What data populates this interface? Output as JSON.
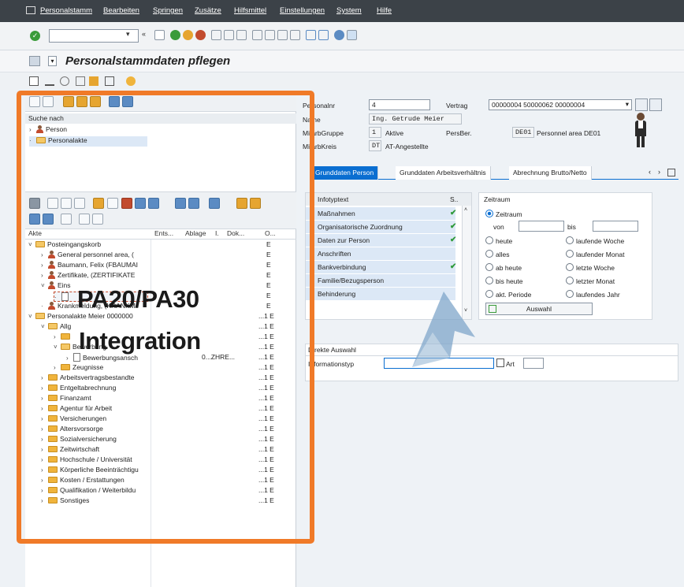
{
  "menubar": {
    "items": [
      "Personalstamm",
      "Bearbeiten",
      "Springen",
      "Zusätze",
      "Hilfsmittel",
      "Einstellungen",
      "System",
      "Hilfe"
    ]
  },
  "title": {
    "text": "Personalstammdaten pflegen"
  },
  "left": {
    "search_header": "Suche nach",
    "search_tree": [
      {
        "label": "Person",
        "expander": "›"
      },
      {
        "label": "Personalakte",
        "expander": "·"
      }
    ],
    "columns": [
      "Akte",
      "Ents...",
      "Ablage",
      "I.",
      "Dok...",
      "O..."
    ],
    "tree": [
      {
        "label": "Posteingangskorb",
        "e": "E",
        "expander": "˅"
      },
      {
        "label": "General personnel area, (",
        "e": "E",
        "expander": "›"
      },
      {
        "label": "Baumann, Felix (FBAUMAI",
        "e": "E",
        "expander": "›"
      },
      {
        "label": "Zertifikate, (ZERTIFIKATE",
        "e": "E",
        "expander": "›"
      },
      {
        "label": "Eins",
        "e": "E",
        "expander": "˅"
      },
      {
        "label": "",
        "e": "E",
        "expander": "·"
      },
      {
        "label": "Krankmeldung, (KRANKM",
        "e": "E",
        "expander": "·"
      },
      {
        "label": "Personalakte Meier 0000000",
        "e": "...1 E",
        "expander": "˅"
      },
      {
        "label": "Allg",
        "e": "...1 E",
        "expander": "˅"
      },
      {
        "label": "",
        "e": "...1 E",
        "expander": "›"
      },
      {
        "label": "Bewerbung",
        "e": "...1 E",
        "expander": "˅"
      },
      {
        "label": "Bewerbungsansch",
        "e": "...1 E",
        "expander": "›",
        "extra": "0...ZHRE..."
      },
      {
        "label": "Zeugnisse",
        "e": "...1 E",
        "expander": "›"
      },
      {
        "label": "Arbeitsvertragsbestandte",
        "e": "...1 E",
        "expander": "›"
      },
      {
        "label": "Entgeltabrechnung",
        "e": "...1 E",
        "expander": "›"
      },
      {
        "label": "Finanzamt",
        "e": "...1 E",
        "expander": "›"
      },
      {
        "label": "Agentur für Arbeit",
        "e": "...1 E",
        "expander": "›"
      },
      {
        "label": "Versicherungen",
        "e": "...1 E",
        "expander": "›"
      },
      {
        "label": "Altersvorsorge",
        "e": "...1 E",
        "expander": "›"
      },
      {
        "label": "Sozialversicherung",
        "e": "...1 E",
        "expander": "›"
      },
      {
        "label": "Zeitwirtschaft",
        "e": "...1 E",
        "expander": "›"
      },
      {
        "label": "Hochschule / Universität",
        "e": "...1 E",
        "expander": "›"
      },
      {
        "label": "Körperliche Beeinträchtigu",
        "e": "...1 E",
        "expander": "›"
      },
      {
        "label": "Kosten / Erstattungen",
        "e": "...1 E",
        "expander": "›"
      },
      {
        "label": "Qualifikation / Weiterbildu",
        "e": "...1 E",
        "expander": "›"
      },
      {
        "label": "Sonstiges",
        "e": "...1 E",
        "expander": "›"
      }
    ]
  },
  "header": {
    "persnr_label": "Personalnr",
    "persnr": "4",
    "vertrag_label": "Vertrag",
    "vertrag": "00000004 50000062 00000004",
    "name_label": "Name",
    "name": "Ing. Getrude Meier",
    "gruppe_label": "MitarbGruppe",
    "gruppe_code": "1",
    "gruppe": "Aktive",
    "persber_label": "PersBer.",
    "persber_code": "DE01",
    "persber": "Personnel area DE01",
    "kreis_label": "MitarbKreis",
    "kreis_code": "DT",
    "kreis": "AT-Angestellte"
  },
  "tabs": [
    "Grunddaten Person",
    "Grunddaten Arbeitsverhältnis",
    "Abrechnung Brutto/Netto"
  ],
  "infotypes": {
    "col_text": "Infotyptext",
    "col_s": "S..",
    "rows": [
      {
        "label": "Maßnahmen",
        "check": "✔"
      },
      {
        "label": "Organisatorische Zuordnung",
        "check": "✔"
      },
      {
        "label": "Daten zur Person",
        "check": "✔"
      },
      {
        "label": "Anschriften",
        "check": ""
      },
      {
        "label": "Bankverbindung",
        "check": "✔"
      },
      {
        "label": "Familie/Bezugsperson",
        "check": ""
      },
      {
        "label": "Behinderung",
        "check": ""
      }
    ]
  },
  "zeitraum": {
    "title": "Zeitraum",
    "selected": "Zeitraum",
    "von": "von",
    "bis": "bis",
    "options_left": [
      "heute",
      "alles",
      "ab heute",
      "bis heute",
      "akt. Periode"
    ],
    "options_right": [
      "laufende Woche",
      "laufender Monat",
      "letzte Woche",
      "letzter Monat",
      "laufendes Jahr"
    ],
    "button": "Auswahl"
  },
  "direct": {
    "title": "Direkte Auswahl",
    "infotyp_label": "Informationstyp",
    "art_label": "Art"
  },
  "overlay": {
    "line1": "PA20/PA30",
    "line2": "Integration",
    "frame_color": "#f07a28"
  }
}
